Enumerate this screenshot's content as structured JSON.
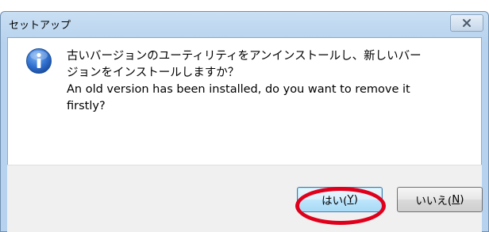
{
  "window": {
    "title": "セットアップ",
    "close_glyph": "✕"
  },
  "message": {
    "line1": "古いバージョンのユーティリティをアンインストールし、新しいバー",
    "line2": "ジョンをインストールしますか？",
    "line3": "An old version has been installed, do you want to remove it",
    "line4": "firstly?"
  },
  "buttons": {
    "yes_prefix": "はい(",
    "yes_key": "Y",
    "yes_suffix": ")",
    "no_prefix": "いいえ(",
    "no_key": "N",
    "no_suffix": ")"
  },
  "icons": {
    "info": "info-icon",
    "close": "close-icon"
  },
  "colors": {
    "highlight_oval": "#e0001b"
  }
}
